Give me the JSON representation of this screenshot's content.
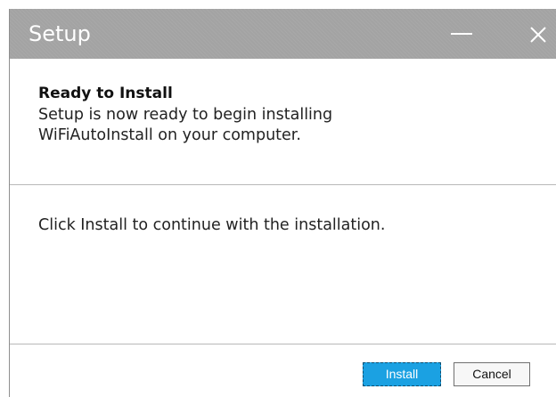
{
  "window": {
    "title": "Setup",
    "minimize_icon": "minimize-icon",
    "close_icon": "close-icon"
  },
  "header": {
    "heading": "Ready to Install",
    "line1": "Setup is now ready to begin installing",
    "line2": "WiFiAutoInstall on your computer."
  },
  "body": {
    "message": "Click Install to continue with the installation."
  },
  "buttons": {
    "install_label": "Install",
    "cancel_label": "Cancel"
  },
  "colors": {
    "titlebar": "#a3a3a3",
    "install_button": "#1ba1e2",
    "title_text": "#ffffff"
  }
}
